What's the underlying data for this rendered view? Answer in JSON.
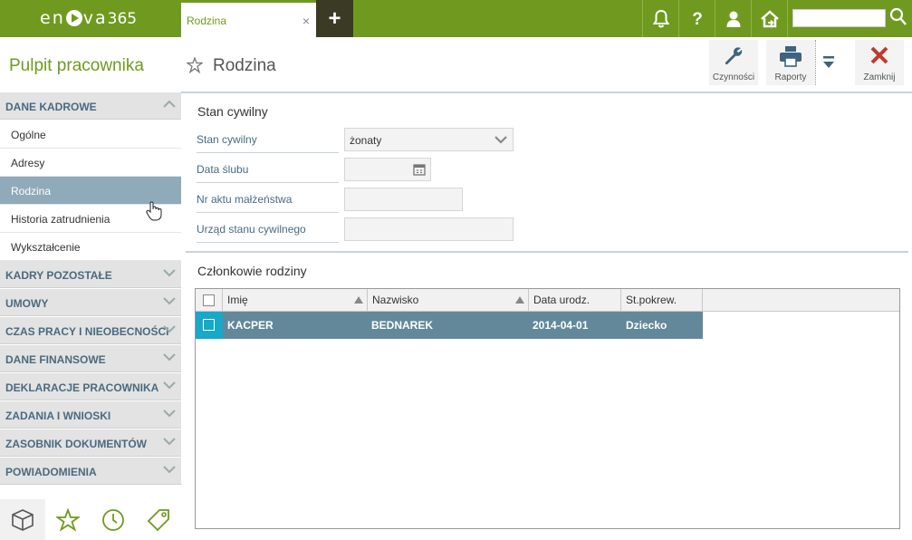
{
  "header": {
    "logo_left": "en",
    "logo_right": "va",
    "logo_num": "365",
    "tab_label": "Rodzina",
    "tab_close": "×",
    "add_tab": "+"
  },
  "sidebar": {
    "title": "Pulpit pracownika",
    "sections": [
      {
        "label": "DANE KADROWE",
        "expanded": true
      },
      {
        "label": "KADRY POZOSTAŁE"
      },
      {
        "label": "UMOWY"
      },
      {
        "label": "CZAS PRACY I NIEOBECNOŚCI"
      },
      {
        "label": "DANE FINANSOWE"
      },
      {
        "label": "DEKLARACJE PRACOWNIKA"
      },
      {
        "label": "ZADANIA I WNIOSKI"
      },
      {
        "label": "ZASOBNIK DOKUMENTÓW"
      },
      {
        "label": "POWIADOMIENIA"
      }
    ],
    "items": [
      {
        "label": "Ogólne"
      },
      {
        "label": "Adresy"
      },
      {
        "label": "Rodzina",
        "active": true
      },
      {
        "label": "Historia zatrudnienia"
      },
      {
        "label": "Wykształcenie"
      }
    ]
  },
  "page": {
    "title": "Rodzina",
    "toolbar": {
      "actions_label": "Czynności",
      "reports_label": "Raporty",
      "close_label": "Zamknij"
    }
  },
  "form": {
    "group_title": "Stan cywilny",
    "marital_status_label": "Stan cywilny",
    "marital_status_value": "żonaty",
    "wedding_date_label": "Data ślubu",
    "marriage_act_label": "Nr aktu małżeństwa",
    "registry_office_label": "Urząd stanu cywilnego"
  },
  "family": {
    "group_title": "Członkowie rodziny",
    "columns": [
      "Imię",
      "Nazwisko",
      "Data urodz.",
      "St.pokrew."
    ],
    "rows": [
      {
        "first_name": "KACPER",
        "last_name": "BEDNAREK",
        "birth_date": "2014-04-01",
        "relation": "Dziecko"
      }
    ]
  },
  "colors": {
    "brand_green": "#6f9a1f",
    "active_item": "#8faab8",
    "selected_row": "#63889a",
    "close_red": "#c0392b"
  }
}
